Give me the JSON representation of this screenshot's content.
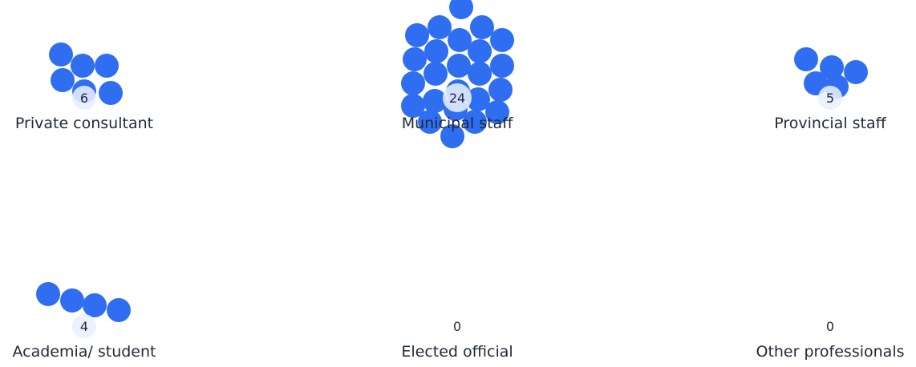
{
  "chart_data": {
    "type": "bubble-cluster",
    "colors": {
      "dot": "#2f6ef0",
      "count_disc": "#e8efff",
      "text": "#1f2937"
    },
    "groups": [
      {
        "label": "Private consultant",
        "count": 6
      },
      {
        "label": "Municipal staff",
        "count": 24
      },
      {
        "label": "Provincial staff",
        "count": 5
      },
      {
        "label": "Academia/ student",
        "count": 4
      },
      {
        "label": "Elected official",
        "count": 0
      },
      {
        "label": "Other professionals",
        "count": 0
      }
    ]
  }
}
